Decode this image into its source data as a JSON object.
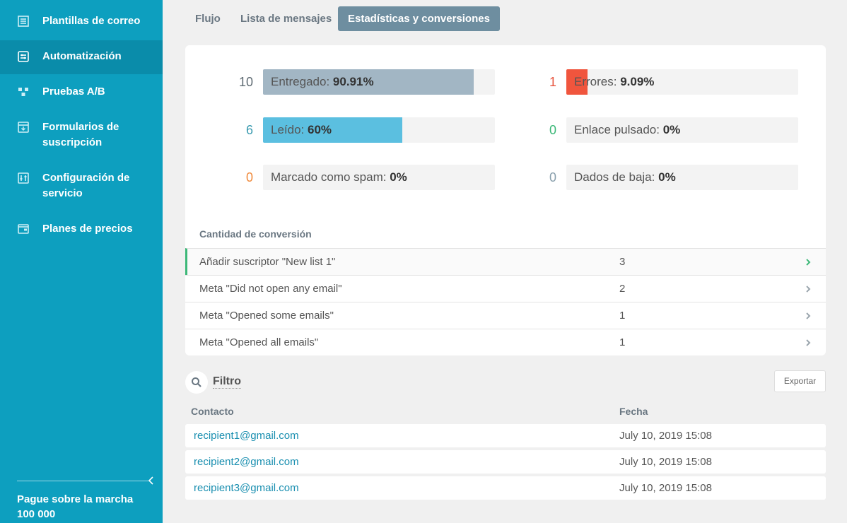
{
  "sidebar": {
    "items": [
      {
        "label": "Plantillas de correo",
        "icon": "email-template-icon"
      },
      {
        "label": "Automatización",
        "icon": "automation-icon"
      },
      {
        "label": "Pruebas A/B",
        "icon": "ab-test-icon"
      },
      {
        "label": "Formularios de suscripción",
        "icon": "form-icon"
      },
      {
        "label": "Configuración de servicio",
        "icon": "settings-icon"
      },
      {
        "label": "Planes de precios",
        "icon": "wallet-icon"
      }
    ],
    "plan": "Pague sobre la marcha 100 000"
  },
  "tabs": [
    {
      "label": "Flujo"
    },
    {
      "label": "Lista de mensajes"
    },
    {
      "label": "Estadísticas y conversiones"
    }
  ],
  "stats": [
    {
      "count": "10",
      "label": "Entregado:",
      "value": "90.91%",
      "fraction": 0.9091,
      "count_color": "#5f6b73",
      "fill_color": "#a2b6c4"
    },
    {
      "count": "1",
      "label": "Errores:",
      "value": "9.09%",
      "fraction": 0.0909,
      "count_color": "#e8553f",
      "fill_color": "#f0553d"
    },
    {
      "count": "6",
      "label": "Leído:",
      "value": "60%",
      "fraction": 0.6,
      "count_color": "#3a9bb0",
      "fill_color": "#5bbfe0"
    },
    {
      "count": "0",
      "label": "Enlace pulsado:",
      "value": "0%",
      "fraction": 0,
      "count_color": "#3cb878",
      "fill_color": "#3cb878"
    },
    {
      "count": "0",
      "label": "Marcado como spam:",
      "value": "0%",
      "fraction": 0,
      "count_color": "#f08a3c",
      "fill_color": "#f08a3c"
    },
    {
      "count": "0",
      "label": "Dados de baja:",
      "value": "0%",
      "fraction": 0,
      "count_color": "#8aa0ad",
      "fill_color": "#8aa0ad"
    }
  ],
  "conversions": {
    "title": "Cantidad de conversión",
    "rows": [
      {
        "name": "Añadir suscriptor \"New list 1\"",
        "count": "3"
      },
      {
        "name": "Meta \"Did not open any email\"",
        "count": "2"
      },
      {
        "name": "Meta \"Opened some emails\"",
        "count": "1"
      },
      {
        "name": "Meta \"Opened all emails\"",
        "count": "1"
      }
    ]
  },
  "filter": {
    "label": "Filtro",
    "export": "Exportar"
  },
  "contacts": {
    "headers": {
      "contact": "Contacto",
      "date": "Fecha"
    },
    "rows": [
      {
        "email": "recipient1@gmail.com",
        "date": "July 10, 2019 15:08"
      },
      {
        "email": "recipient2@gmail.com",
        "date": "July 10, 2019 15:08"
      },
      {
        "email": "recipient3@gmail.com",
        "date": "July 10, 2019 15:08"
      }
    ]
  },
  "colors": {
    "sidebar": "#0d9fbf",
    "sidebar_active": "#0a8caa",
    "active_tab": "#6e8ea0",
    "link": "#1a8fb0",
    "success": "#3cb878"
  }
}
